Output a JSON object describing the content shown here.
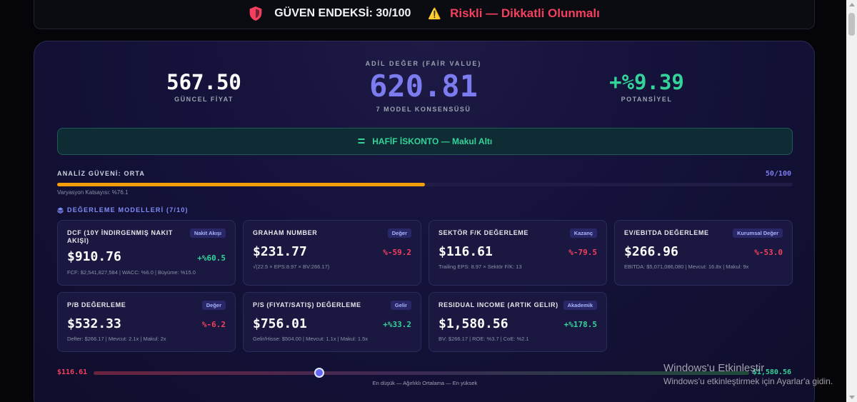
{
  "banner": {
    "score_text": "GÜVEN ENDEKSİ: 30/100",
    "risk_text": "Riskli — Dikkatli Olunmalı",
    "shield_color": "#f43f5e",
    "warning_icon": "⚠️"
  },
  "summary": {
    "current_price": "567.50",
    "current_price_label": "GÜNCEL FİYAT",
    "fair_value_label": "ADİL DEĞER (FAİR VALUE)",
    "fair_value": "620.81",
    "consensus_label": "7 MODEL KONSENSÜSÜ",
    "potential": "+%9.39",
    "potential_label": "POTANSİYEL"
  },
  "verdict": {
    "icon": "=",
    "text": "HAFİF İSKONTO — Makul Altı"
  },
  "confidence": {
    "label": "ANALİZ GÜVENİ: ORTA",
    "score_text": "50/100",
    "fill_fraction": 0.5,
    "variation_note": "Varyasyon Katsayısı: %76.1"
  },
  "models_section": {
    "title": "DEĞERLEME MODELLERİ (7/10)"
  },
  "models": [
    {
      "name": "DCF (10Y İndirgenmiş Nakit Akışı)",
      "tag": "Nakit Akışı",
      "value": "$910.76",
      "pct": "+%60.5",
      "positive": true,
      "sub": "FCF: $2,541,827,584 | WACC: %6.0 | Büyüme: %15.0"
    },
    {
      "name": "Graham Number",
      "tag": "Değer",
      "value": "$231.77",
      "pct": "%-59.2",
      "positive": false,
      "sub": "√(22.5 × EPS:8.97 × BV:266.17)"
    },
    {
      "name": "Sektör F/K Değerleme",
      "tag": "Kazanç",
      "value": "$116.61",
      "pct": "%-79.5",
      "positive": false,
      "sub": "Trailing EPS: 8.97 × Sektör F/K: 13"
    },
    {
      "name": "EV/EBITDA Değerleme",
      "tag": "Kurumsal Değer",
      "value": "$266.96",
      "pct": "%-53.0",
      "positive": false,
      "sub": "EBITDA: $5,071,086,080 | Mevcut: 16.8x | Makul: 9x"
    },
    {
      "name": "P/B Değerleme",
      "tag": "Değer",
      "value": "$532.33",
      "pct": "%-6.2",
      "positive": false,
      "sub": "Defter: $266.17 | Mevcut: 2.1x | Makul: 2x"
    },
    {
      "name": "P/S (Fiyat/Satış) Değerleme",
      "tag": "Gelir",
      "value": "$756.01",
      "pct": "+%33.2",
      "positive": true,
      "sub": "Gelir/Hisse: $504.00 | Mevcut: 1.1x | Makul: 1.5x"
    },
    {
      "name": "Residual Income (Artık Gelir)",
      "tag": "Akademik",
      "value": "$1,580.56",
      "pct": "+%178.5",
      "positive": true,
      "sub": "BV: $266.17 | ROE: %3.7 | CoE: %2.1"
    }
  ],
  "range": {
    "low": "$116.61",
    "high": "$1,580.56",
    "low_value": 116.61,
    "high_value": 1580.56,
    "marker_value": 620.81,
    "caption": "En düşük — Ağırlıklı Ortalama — En yüksek"
  },
  "watermark": {
    "line1": "Windows'u Etkinleştir",
    "line2": "Windows'u etkinleştirmek için Ayarlar'a gidin."
  }
}
